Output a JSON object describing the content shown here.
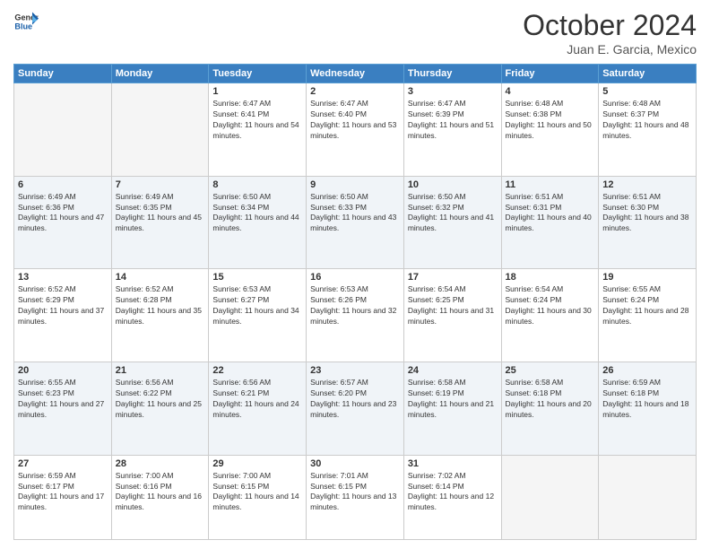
{
  "header": {
    "logo_line1": "General",
    "logo_line2": "Blue",
    "month": "October 2024",
    "location": "Juan E. Garcia, Mexico"
  },
  "weekdays": [
    "Sunday",
    "Monday",
    "Tuesday",
    "Wednesday",
    "Thursday",
    "Friday",
    "Saturday"
  ],
  "weeks": [
    [
      {
        "day": "",
        "info": ""
      },
      {
        "day": "",
        "info": ""
      },
      {
        "day": "1",
        "info": "Sunrise: 6:47 AM\nSunset: 6:41 PM\nDaylight: 11 hours and 54 minutes."
      },
      {
        "day": "2",
        "info": "Sunrise: 6:47 AM\nSunset: 6:40 PM\nDaylight: 11 hours and 53 minutes."
      },
      {
        "day": "3",
        "info": "Sunrise: 6:47 AM\nSunset: 6:39 PM\nDaylight: 11 hours and 51 minutes."
      },
      {
        "day": "4",
        "info": "Sunrise: 6:48 AM\nSunset: 6:38 PM\nDaylight: 11 hours and 50 minutes."
      },
      {
        "day": "5",
        "info": "Sunrise: 6:48 AM\nSunset: 6:37 PM\nDaylight: 11 hours and 48 minutes."
      }
    ],
    [
      {
        "day": "6",
        "info": "Sunrise: 6:49 AM\nSunset: 6:36 PM\nDaylight: 11 hours and 47 minutes."
      },
      {
        "day": "7",
        "info": "Sunrise: 6:49 AM\nSunset: 6:35 PM\nDaylight: 11 hours and 45 minutes."
      },
      {
        "day": "8",
        "info": "Sunrise: 6:50 AM\nSunset: 6:34 PM\nDaylight: 11 hours and 44 minutes."
      },
      {
        "day": "9",
        "info": "Sunrise: 6:50 AM\nSunset: 6:33 PM\nDaylight: 11 hours and 43 minutes."
      },
      {
        "day": "10",
        "info": "Sunrise: 6:50 AM\nSunset: 6:32 PM\nDaylight: 11 hours and 41 minutes."
      },
      {
        "day": "11",
        "info": "Sunrise: 6:51 AM\nSunset: 6:31 PM\nDaylight: 11 hours and 40 minutes."
      },
      {
        "day": "12",
        "info": "Sunrise: 6:51 AM\nSunset: 6:30 PM\nDaylight: 11 hours and 38 minutes."
      }
    ],
    [
      {
        "day": "13",
        "info": "Sunrise: 6:52 AM\nSunset: 6:29 PM\nDaylight: 11 hours and 37 minutes."
      },
      {
        "day": "14",
        "info": "Sunrise: 6:52 AM\nSunset: 6:28 PM\nDaylight: 11 hours and 35 minutes."
      },
      {
        "day": "15",
        "info": "Sunrise: 6:53 AM\nSunset: 6:27 PM\nDaylight: 11 hours and 34 minutes."
      },
      {
        "day": "16",
        "info": "Sunrise: 6:53 AM\nSunset: 6:26 PM\nDaylight: 11 hours and 32 minutes."
      },
      {
        "day": "17",
        "info": "Sunrise: 6:54 AM\nSunset: 6:25 PM\nDaylight: 11 hours and 31 minutes."
      },
      {
        "day": "18",
        "info": "Sunrise: 6:54 AM\nSunset: 6:24 PM\nDaylight: 11 hours and 30 minutes."
      },
      {
        "day": "19",
        "info": "Sunrise: 6:55 AM\nSunset: 6:24 PM\nDaylight: 11 hours and 28 minutes."
      }
    ],
    [
      {
        "day": "20",
        "info": "Sunrise: 6:55 AM\nSunset: 6:23 PM\nDaylight: 11 hours and 27 minutes."
      },
      {
        "day": "21",
        "info": "Sunrise: 6:56 AM\nSunset: 6:22 PM\nDaylight: 11 hours and 25 minutes."
      },
      {
        "day": "22",
        "info": "Sunrise: 6:56 AM\nSunset: 6:21 PM\nDaylight: 11 hours and 24 minutes."
      },
      {
        "day": "23",
        "info": "Sunrise: 6:57 AM\nSunset: 6:20 PM\nDaylight: 11 hours and 23 minutes."
      },
      {
        "day": "24",
        "info": "Sunrise: 6:58 AM\nSunset: 6:19 PM\nDaylight: 11 hours and 21 minutes."
      },
      {
        "day": "25",
        "info": "Sunrise: 6:58 AM\nSunset: 6:18 PM\nDaylight: 11 hours and 20 minutes."
      },
      {
        "day": "26",
        "info": "Sunrise: 6:59 AM\nSunset: 6:18 PM\nDaylight: 11 hours and 18 minutes."
      }
    ],
    [
      {
        "day": "27",
        "info": "Sunrise: 6:59 AM\nSunset: 6:17 PM\nDaylight: 11 hours and 17 minutes."
      },
      {
        "day": "28",
        "info": "Sunrise: 7:00 AM\nSunset: 6:16 PM\nDaylight: 11 hours and 16 minutes."
      },
      {
        "day": "29",
        "info": "Sunrise: 7:00 AM\nSunset: 6:15 PM\nDaylight: 11 hours and 14 minutes."
      },
      {
        "day": "30",
        "info": "Sunrise: 7:01 AM\nSunset: 6:15 PM\nDaylight: 11 hours and 13 minutes."
      },
      {
        "day": "31",
        "info": "Sunrise: 7:02 AM\nSunset: 6:14 PM\nDaylight: 11 hours and 12 minutes."
      },
      {
        "day": "",
        "info": ""
      },
      {
        "day": "",
        "info": ""
      }
    ]
  ]
}
